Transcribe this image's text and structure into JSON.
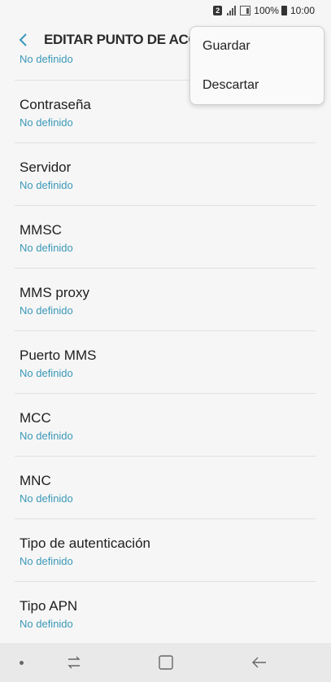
{
  "status_bar": {
    "sim_label": "2",
    "battery": "100%",
    "time": "10:00"
  },
  "header": {
    "title": "EDITAR PUNTO DE ACCESO"
  },
  "menu": {
    "items": [
      {
        "label": "Guardar"
      },
      {
        "label": "Descartar"
      }
    ]
  },
  "list": {
    "first_value": "No definido",
    "items": [
      {
        "label": "Contraseña",
        "value": "No definido"
      },
      {
        "label": "Servidor",
        "value": "No definido"
      },
      {
        "label": "MMSC",
        "value": "No definido"
      },
      {
        "label": "MMS proxy",
        "value": "No definido"
      },
      {
        "label": "Puerto MMS",
        "value": "No definido"
      },
      {
        "label": "MCC",
        "value": "No definido"
      },
      {
        "label": "MNC",
        "value": "No definido"
      },
      {
        "label": "Tipo de autenticación",
        "value": "No definido"
      },
      {
        "label": "Tipo APN",
        "value": "No definido"
      }
    ]
  },
  "colors": {
    "accent": "#3a98b8",
    "background": "#f6f6f6",
    "nav_bar": "#e9e9e9"
  },
  "icons": {
    "back": "chevron-left-icon",
    "recent": "recent-apps-icon",
    "home": "home-icon",
    "nav_back": "back-arrow-icon"
  }
}
